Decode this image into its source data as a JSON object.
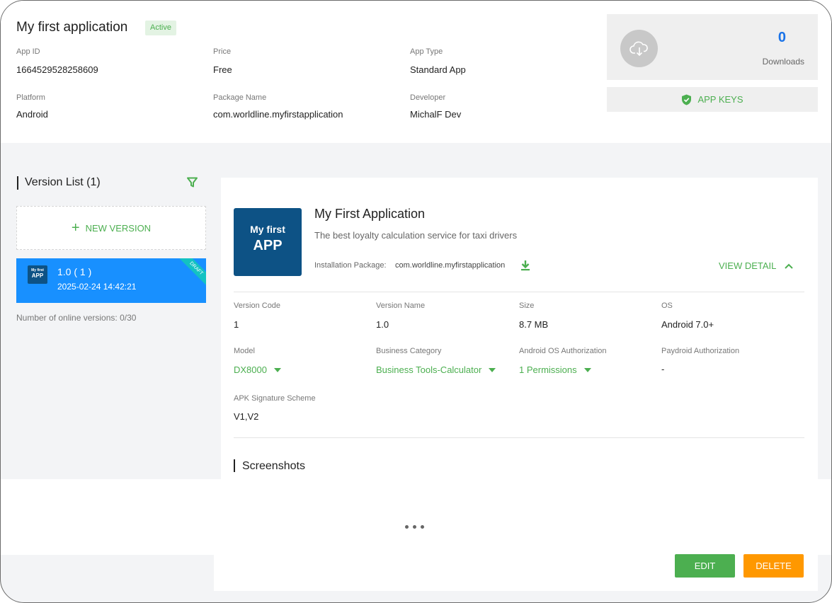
{
  "app": {
    "title": "My first application",
    "status": "Active"
  },
  "info": {
    "app_id_label": "App ID",
    "app_id": "1664529528258609",
    "price_label": "Price",
    "price": "Free",
    "app_type_label": "App Type",
    "app_type": "Standard App",
    "platform_label": "Platform",
    "platform": "Android",
    "package_label": "Package Name",
    "package": "com.worldline.myfirstapplication",
    "developer_label": "Developer",
    "developer": "MichalF Dev"
  },
  "downloads": {
    "count": "0",
    "label": "Downloads"
  },
  "app_keys": {
    "label": "APP KEYS"
  },
  "version_list": {
    "title": "Version List (1)",
    "new_version_label": "NEW VERSION",
    "items": [
      {
        "icon_line1": "My first",
        "icon_line2": "APP",
        "version": "1.0 ( 1 )",
        "date": "2025-02-24 14:42:21",
        "badge": "DRAFT"
      }
    ],
    "online_count": "Number of online versions: 0/30"
  },
  "detail": {
    "icon_line1": "My first",
    "icon_line2": "APP",
    "title": "My First Application",
    "description": "The best loyalty calculation service for taxi drivers",
    "install_label": "Installation Package:",
    "install_value": "com.worldline.myfirstapplication",
    "view_detail": "VIEW DETAIL",
    "fields": {
      "version_code_label": "Version Code",
      "version_code": "1",
      "version_name_label": "Version Name",
      "version_name": "1.0",
      "size_label": "Size",
      "size": "8.7 MB",
      "os_label": "OS",
      "os": "Android 7.0+",
      "model_label": "Model",
      "model": "DX8000",
      "category_label": "Business Category",
      "category": "Business Tools-Calculator",
      "authorization_label": "Android OS Authorization",
      "authorization": "1 Permissions",
      "paydroid_label": "Paydroid Authorization",
      "paydroid": "-",
      "signature_label": "APK Signature Scheme",
      "signature": "V1,V2"
    },
    "screenshots_title": "Screenshots"
  },
  "actions": {
    "edit": "EDIT",
    "delete": "DELETE"
  },
  "colors": {
    "accent_green": "#4caf50",
    "selected_blue": "#1890ff",
    "delete_orange": "#ff9800",
    "link_blue": "#1a73e8"
  }
}
